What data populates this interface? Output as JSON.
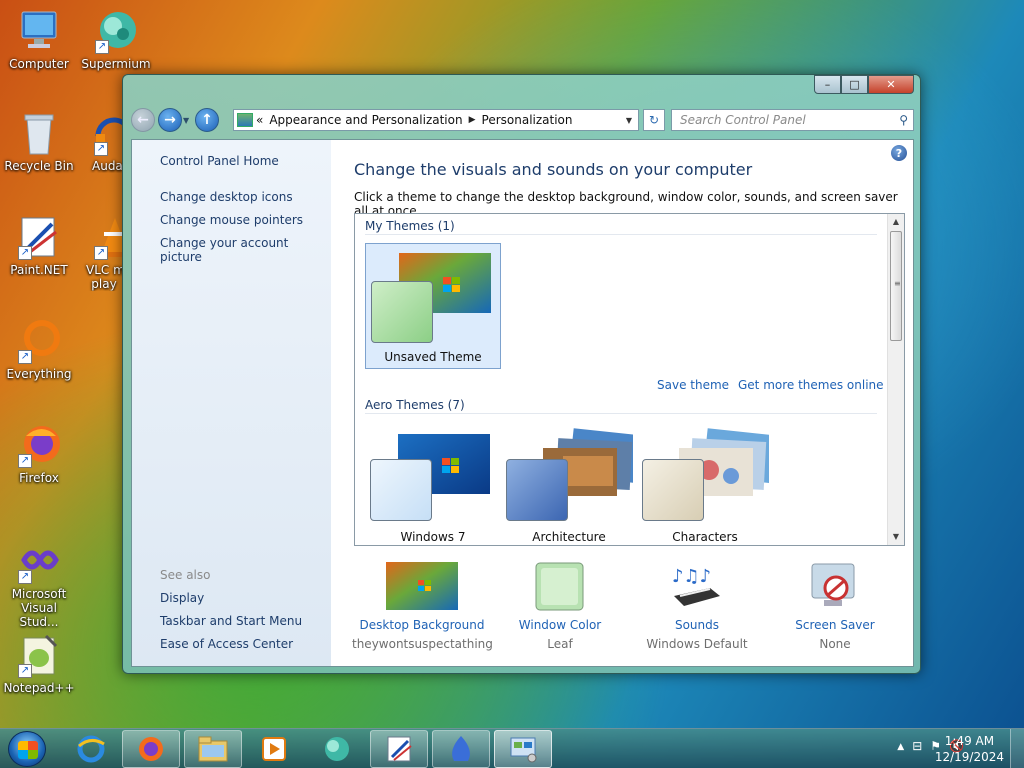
{
  "desktop": {
    "icons": [
      {
        "label": "Computer"
      },
      {
        "label": "Supermium"
      },
      {
        "label": "Recycle Bin"
      },
      {
        "label": "Auda"
      },
      {
        "label": "Paint.NET"
      },
      {
        "label": "VLC m\nplay"
      },
      {
        "label": "Everything"
      },
      {
        "label": "Firefox"
      },
      {
        "label": "Microsoft Visual Stud..."
      },
      {
        "label": "Notepad++"
      }
    ]
  },
  "window": {
    "caption": {
      "min": "–",
      "max": "□",
      "close": "✕"
    },
    "address": {
      "chevron": "«",
      "crumbs": [
        "Appearance and Personalization",
        "Personalization"
      ],
      "separator": "▶"
    },
    "search": {
      "placeholder": "Search Control Panel"
    },
    "left_pane": {
      "home": "Control Panel Home",
      "links": [
        "Change desktop icons",
        "Change mouse pointers",
        "Change your account picture"
      ],
      "see_also": "See also",
      "see_also_links": [
        "Display",
        "Taskbar and Start Menu",
        "Ease of Access Center"
      ]
    },
    "main": {
      "title": "Change the visuals and sounds on your computer",
      "subtitle": "Click a theme to change the desktop background, window color, sounds, and screen saver all at once.",
      "help": "?",
      "my_themes_label": "My Themes (1)",
      "my_themes": [
        {
          "name": "Unsaved Theme",
          "selected": true
        }
      ],
      "save_theme": "Save theme",
      "get_more": "Get more themes online",
      "aero_label": "Aero Themes (7)",
      "aero_themes": [
        {
          "name": "Windows 7"
        },
        {
          "name": "Architecture"
        },
        {
          "name": "Characters"
        }
      ],
      "bottom": [
        {
          "link": "Desktop Background",
          "value": "theywontsuspectathing"
        },
        {
          "link": "Window Color",
          "value": "Leaf"
        },
        {
          "link": "Sounds",
          "value": "Windows Default"
        },
        {
          "link": "Screen Saver",
          "value": "None"
        }
      ]
    }
  },
  "taskbar": {
    "clock_time": "1:49 AM",
    "clock_date": "12/19/2024",
    "tray_up": "▲"
  },
  "colors": {
    "link": "#1f62b5",
    "heading": "#1e3d6b",
    "selection": "#dcebfc"
  }
}
